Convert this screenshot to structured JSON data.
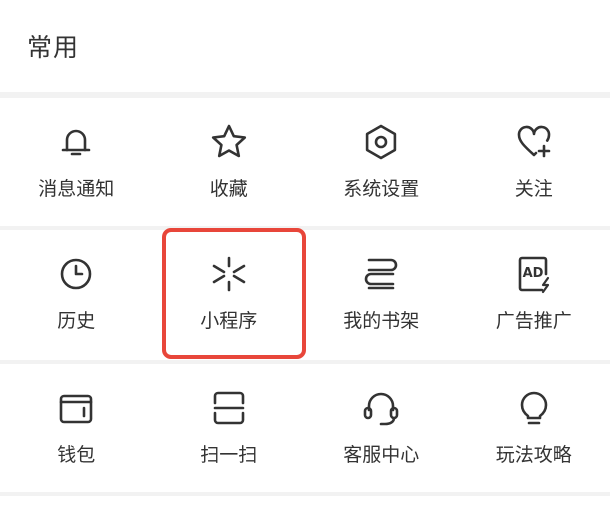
{
  "section": {
    "title": "常用"
  },
  "grid": {
    "rows": [
      [
        {
          "label": "消息通知",
          "icon": "bell-icon"
        },
        {
          "label": "收藏",
          "icon": "star-icon"
        },
        {
          "label": "系统设置",
          "icon": "gear-icon"
        },
        {
          "label": "关注",
          "icon": "heart-plus-icon"
        }
      ],
      [
        {
          "label": "历史",
          "icon": "clock-icon"
        },
        {
          "label": "小程序",
          "icon": "mini-program-icon"
        },
        {
          "label": "我的书架",
          "icon": "bookshelf-icon"
        },
        {
          "label": "广告推广",
          "icon": "ad-icon"
        }
      ],
      [
        {
          "label": "钱包",
          "icon": "wallet-icon"
        },
        {
          "label": "扫一扫",
          "icon": "scan-icon"
        },
        {
          "label": "客服中心",
          "icon": "headset-icon"
        },
        {
          "label": "玩法攻略",
          "icon": "lightbulb-icon"
        }
      ]
    ]
  },
  "highlight": {
    "target": "小程序",
    "color": "#e8463a"
  }
}
